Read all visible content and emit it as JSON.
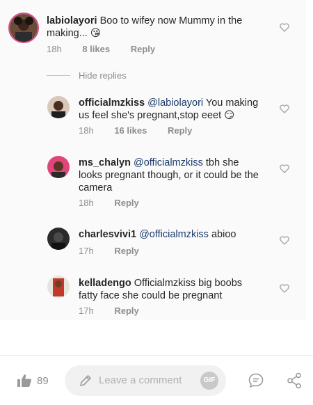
{
  "comments": [
    {
      "username": "labiolayori",
      "text_line1": "Boo to  wifey  now Mummy in the",
      "text_line2": "making... 😘",
      "time": "18h",
      "likes": "8 likes",
      "reply_label": "Reply"
    },
    {
      "username": "officialmzkiss",
      "mention": "@labiolayori",
      "text_line1": " You making",
      "text_line2": "us feel she's pregnant,stop eeet 😏",
      "time": "18h",
      "likes": "16 likes",
      "reply_label": "Reply"
    },
    {
      "username": "ms_chalyn",
      "mention": "@officialmzkiss",
      "text_line1": " tbh she",
      "text_line2": "looks pregnant though, or it could be the",
      "text_line3": "camera",
      "time": "18h",
      "reply_label": "Reply"
    },
    {
      "username": "charlesvivi1",
      "mention": "@officialmzkiss",
      "text_line1": " abioo",
      "time": "17h",
      "reply_label": "Reply"
    },
    {
      "username": "kelladengo",
      "text_line1": "Officialmzkiss big boobs",
      "text_line2": "fatty face she could be pregnant",
      "time": "17h",
      "reply_label": "Reply"
    }
  ],
  "hide_replies_label": "Hide replies",
  "bottom_bar": {
    "like_count": "89",
    "comment_placeholder": "Leave a comment",
    "gif_label": "GIF"
  },
  "colors": {
    "panel_bg": "#fafafa",
    "text": "#262626",
    "muted": "#8e8e8e",
    "mention": "#1b3a6b",
    "heart_stroke": "#a8a8a8"
  },
  "icons": {
    "heart": "heart-outline-icon",
    "like": "thumbs-up-icon",
    "pencil": "pencil-icon",
    "chat": "chat-bubble-icon",
    "share": "share-icon"
  }
}
